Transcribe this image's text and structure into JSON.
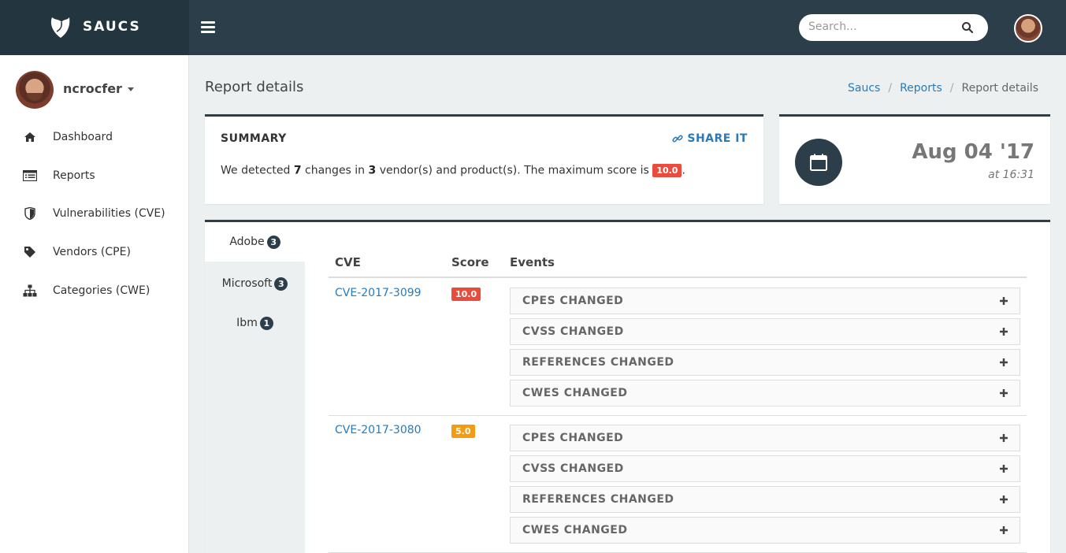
{
  "brand": {
    "name": "SAUCS"
  },
  "search": {
    "placeholder": "Search..."
  },
  "user": {
    "name": "ncrocfer"
  },
  "sidebar": {
    "items": [
      {
        "label": "Dashboard",
        "icon": "home-icon"
      },
      {
        "label": "Reports",
        "icon": "list-icon"
      },
      {
        "label": "Vulnerabilities (CVE)",
        "icon": "shield-icon"
      },
      {
        "label": "Vendors (CPE)",
        "icon": "tag-icon"
      },
      {
        "label": "Categories (CWE)",
        "icon": "sitemap-icon"
      }
    ]
  },
  "page": {
    "title": "Report details"
  },
  "breadcrumb": {
    "items": [
      "Saucs",
      "Reports",
      "Report details"
    ]
  },
  "summary": {
    "title": "SUMMARY",
    "share_label": "SHARE IT",
    "text_before": "We detected ",
    "changes": "7",
    "text_mid": " changes in ",
    "vendors": "3",
    "text_after": " vendor(s) and product(s). The maximum score is ",
    "max_score": "10.0",
    "text_end": "."
  },
  "date": {
    "main": "Aug 04 '17",
    "sub": "at 16:31"
  },
  "vendor_tabs": [
    {
      "name": "Adobe",
      "count": "3"
    },
    {
      "name": "Microsoft",
      "count": "3"
    },
    {
      "name": "Ibm",
      "count": "1"
    }
  ],
  "table": {
    "headers": {
      "cve": "CVE",
      "score": "Score",
      "events": "Events"
    },
    "rows": [
      {
        "cve": "CVE-2017-3099",
        "score": "10.0",
        "score_color": "#e74c3c",
        "events": [
          "CPES CHANGED",
          "CVSS CHANGED",
          "REFERENCES CHANGED",
          "CWES CHANGED"
        ]
      },
      {
        "cve": "CVE-2017-3080",
        "score": "5.0",
        "score_color": "#f39c12",
        "events": [
          "CPES CHANGED",
          "CVSS CHANGED",
          "REFERENCES CHANGED",
          "CWES CHANGED"
        ]
      }
    ]
  },
  "colors": {
    "topbar": "#2c3e4a",
    "brand_bg": "#233640",
    "link": "#2a7ab8"
  }
}
